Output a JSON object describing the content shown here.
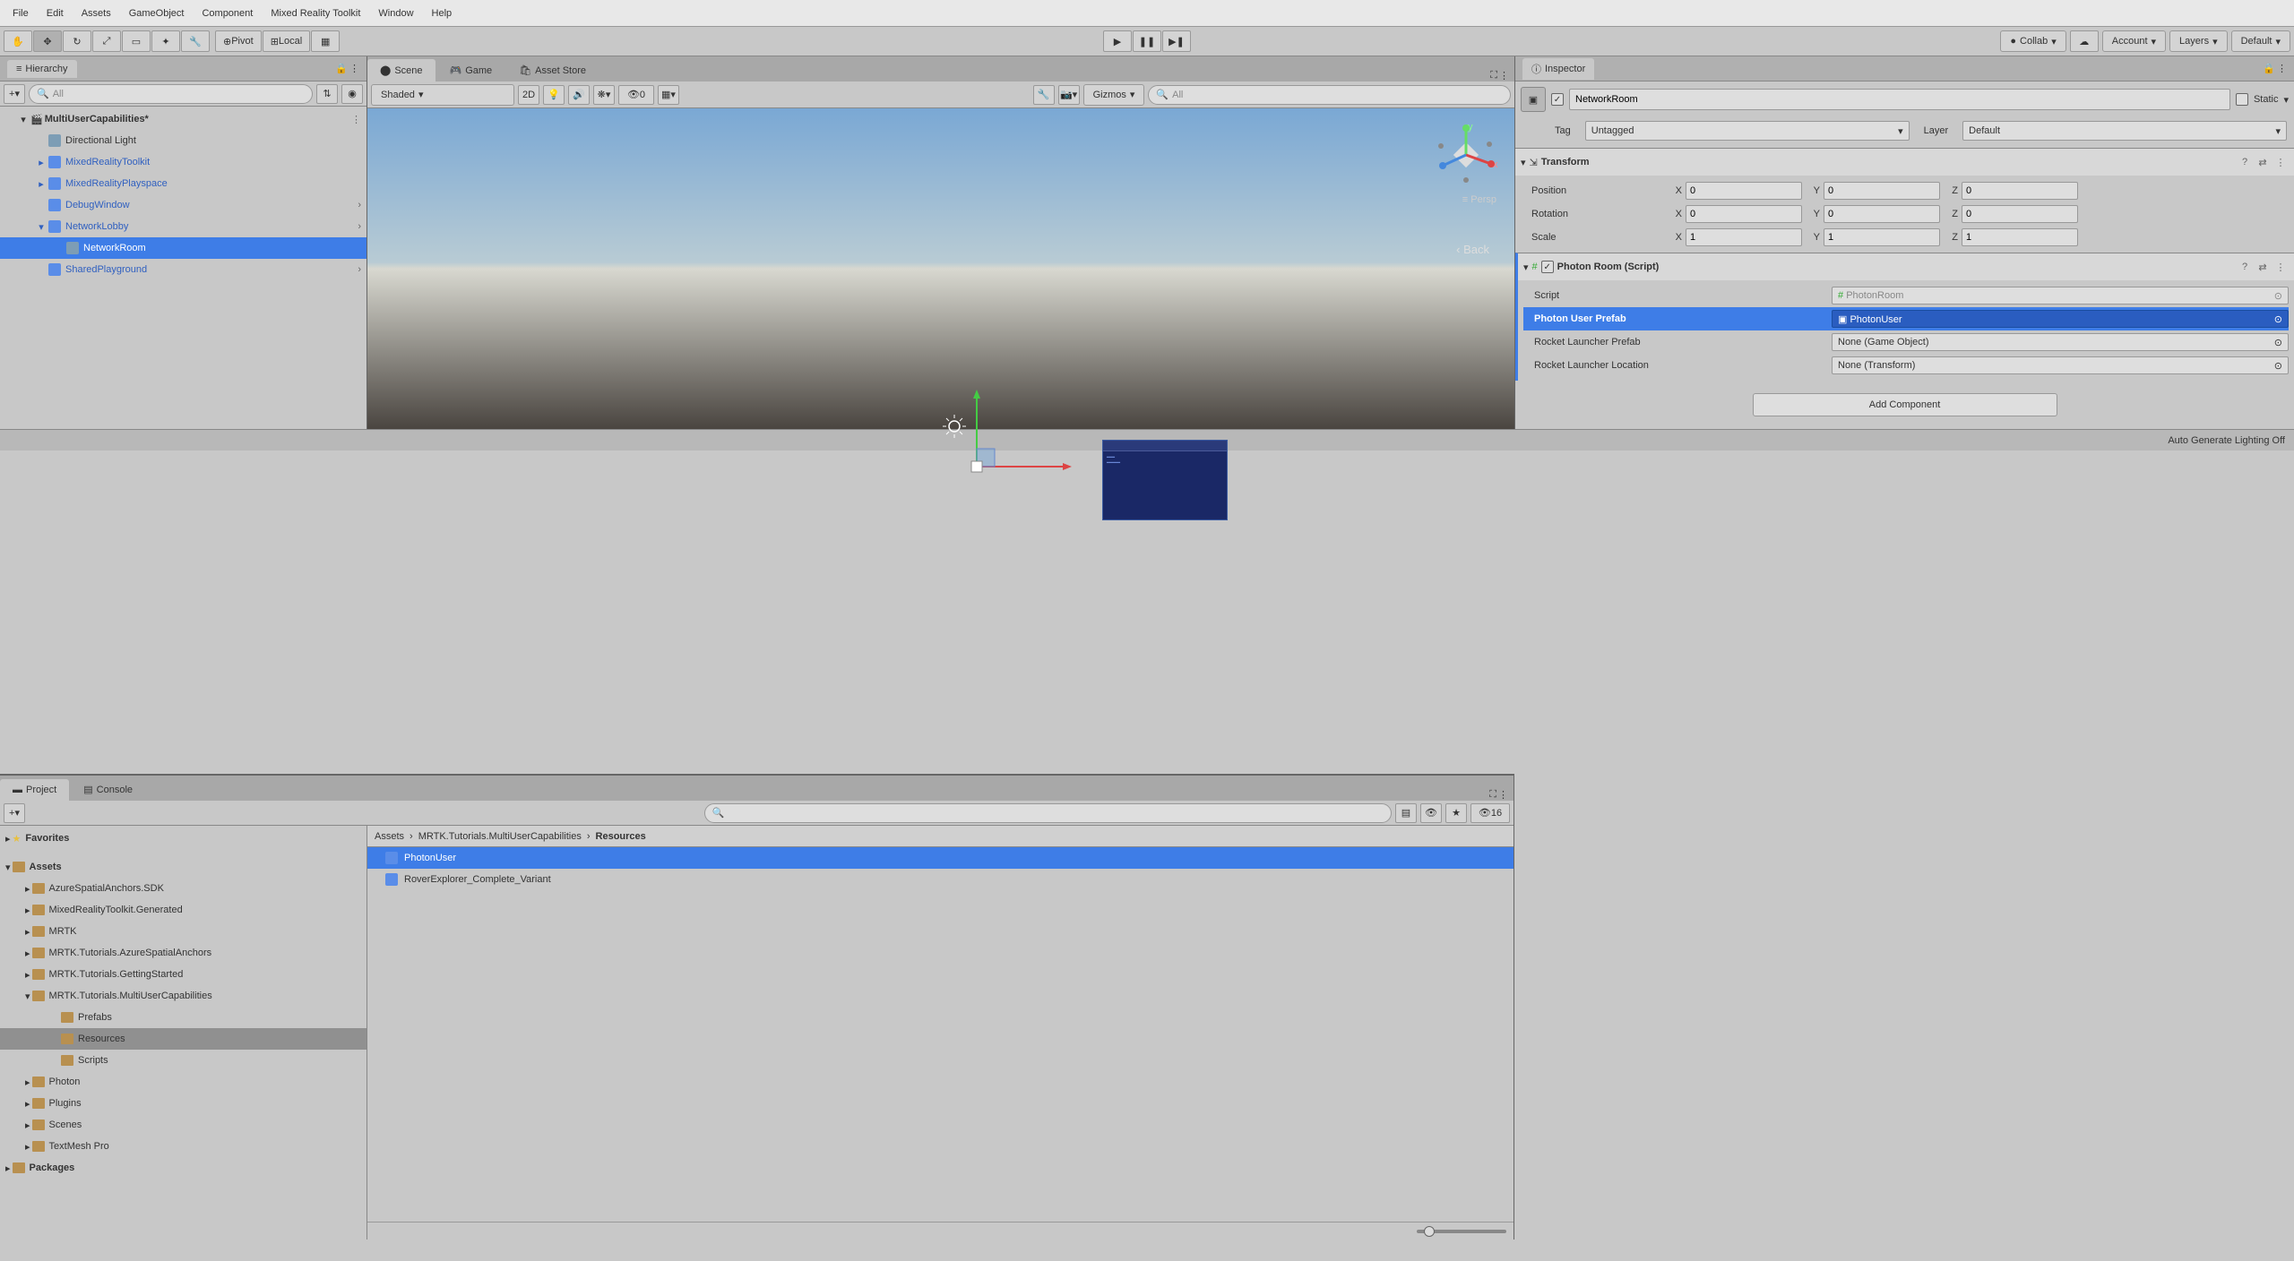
{
  "menubar": [
    "File",
    "Edit",
    "Assets",
    "GameObject",
    "Component",
    "Mixed Reality Toolkit",
    "Window",
    "Help"
  ],
  "toolbar": {
    "pivot": "Pivot",
    "local": "Local",
    "collab": "Collab",
    "account": "Account",
    "layers": "Layers",
    "layout": "Default"
  },
  "hierarchy": {
    "title": "Hierarchy",
    "search_placeholder": "All",
    "scene_name": "MultiUserCapabilities*",
    "items": [
      {
        "name": "Directional Light",
        "indent": 2,
        "prefab": false
      },
      {
        "name": "MixedRealityToolkit",
        "indent": 2,
        "prefab": true,
        "arrow": true
      },
      {
        "name": "MixedRealityPlayspace",
        "indent": 2,
        "prefab": true,
        "arrow": true
      },
      {
        "name": "DebugWindow",
        "indent": 2,
        "prefab": true,
        "expand": true
      },
      {
        "name": "NetworkLobby",
        "indent": 2,
        "prefab": true,
        "arrow_open": true,
        "expand": true
      },
      {
        "name": "NetworkRoom",
        "indent": 3,
        "prefab": false,
        "selected": true
      },
      {
        "name": "SharedPlayground",
        "indent": 2,
        "prefab": true,
        "expand": true
      }
    ]
  },
  "scene_tabs": {
    "scene": "Scene",
    "game": "Game",
    "asset_store": "Asset Store"
  },
  "scene_ctrl": {
    "shaded": "Shaded",
    "two_d": "2D",
    "hidden": "0",
    "gizmos": "Gizmos",
    "search_placeholder": "All"
  },
  "scene_view": {
    "back": "‹ Back",
    "persp": "≡ Persp"
  },
  "inspector": {
    "title": "Inspector",
    "obj_name": "NetworkRoom",
    "static_label": "Static",
    "tag_label": "Tag",
    "tag_value": "Untagged",
    "layer_label": "Layer",
    "layer_value": "Default",
    "transform": {
      "title": "Transform",
      "position": {
        "label": "Position",
        "x": "0",
        "y": "0",
        "z": "0"
      },
      "rotation": {
        "label": "Rotation",
        "x": "0",
        "y": "0",
        "z": "0"
      },
      "scale": {
        "label": "Scale",
        "x": "1",
        "y": "1",
        "z": "1"
      }
    },
    "photon_room": {
      "title": "Photon Room (Script)",
      "script_lbl": "Script",
      "script_val": "PhotonRoom",
      "user_prefab_lbl": "Photon User Prefab",
      "user_prefab_val": "PhotonUser",
      "launcher_prefab_lbl": "Rocket Launcher Prefab",
      "launcher_prefab_val": "None (Game Object)",
      "launcher_loc_lbl": "Rocket Launcher Location",
      "launcher_loc_val": "None (Transform)"
    },
    "add_component": "Add Component"
  },
  "project": {
    "project_tab": "Project",
    "console_tab": "Console",
    "slider_val": "16",
    "favorites": "Favorites",
    "assets_root": "Assets",
    "packages_root": "Packages",
    "folders": [
      {
        "name": "AzureSpatialAnchors.SDK",
        "indent": 2
      },
      {
        "name": "MixedRealityToolkit.Generated",
        "indent": 2
      },
      {
        "name": "MRTK",
        "indent": 2
      },
      {
        "name": "MRTK.Tutorials.AzureSpatialAnchors",
        "indent": 2
      },
      {
        "name": "MRTK.Tutorials.GettingStarted",
        "indent": 2
      },
      {
        "name": "MRTK.Tutorials.MultiUserCapabilities",
        "indent": 2,
        "open": true
      },
      {
        "name": "Prefabs",
        "indent": 3
      },
      {
        "name": "Resources",
        "indent": 3,
        "selected": true
      },
      {
        "name": "Scripts",
        "indent": 3
      },
      {
        "name": "Photon",
        "indent": 2
      },
      {
        "name": "Plugins",
        "indent": 2
      },
      {
        "name": "Scenes",
        "indent": 2
      },
      {
        "name": "TextMesh Pro",
        "indent": 2
      }
    ],
    "breadcrumb": [
      "Assets",
      "MRTK.Tutorials.MultiUserCapabilities",
      "Resources"
    ],
    "assets": [
      {
        "name": "PhotonUser",
        "selected": true
      },
      {
        "name": "RoverExplorer_Complete_Variant",
        "selected": false
      }
    ]
  },
  "statusbar": "Auto Generate Lighting Off"
}
